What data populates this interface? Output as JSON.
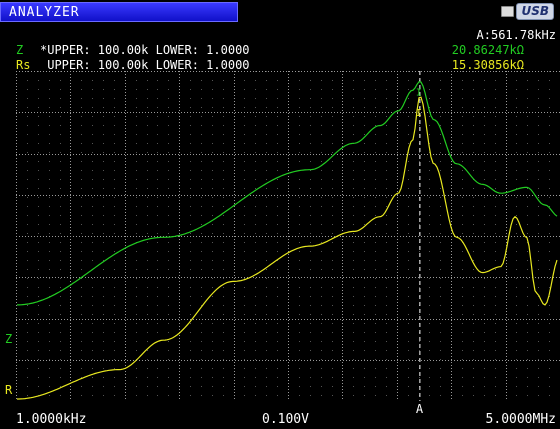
{
  "header": {
    "title": "ANALYZER",
    "usb_label": "USB"
  },
  "readout": {
    "cursor": "A:561.78kHz",
    "z_name": "Z",
    "z_limits": "*UPPER: 100.00k LOWER: 1.0000",
    "z_value": "20.86247kΩ",
    "rs_name": "Rs",
    "rs_limits": " UPPER: 100.00k LOWER: 1.0000",
    "rs_value": "15.30856kΩ"
  },
  "plot": {
    "z_marker": "Z",
    "r_marker": "R",
    "cursor_marker": "A",
    "x_start": "1.0000kHz",
    "x_center": "0.100V",
    "x_end": "5.0000MHz"
  },
  "colors": {
    "z": "#22cc22",
    "rs": "#e8e820",
    "grid": "#9a9a9a",
    "tab": "#2020e0"
  },
  "chart_data": {
    "type": "line",
    "xscale": "log",
    "xlim": [
      "1.0000kHz",
      "5.0000MHz"
    ],
    "grid": true,
    "cursor": {
      "label": "A",
      "x": "561.78kHz"
    },
    "series": [
      {
        "name": "Z",
        "color": "#22cc22",
        "x_khz": [
          1,
          10,
          100,
          200,
          300,
          400,
          500,
          561.78,
          700,
          1000,
          1500,
          2000,
          3000,
          4000,
          5000
        ],
        "y_rel": [
          0.32,
          0.55,
          0.78,
          0.87,
          0.93,
          0.98,
          1.05,
          1.08,
          0.95,
          0.8,
          0.73,
          0.7,
          0.72,
          0.66,
          0.62
        ]
      },
      {
        "name": "Rs",
        "color": "#e8e820",
        "x_khz": [
          1,
          5,
          10,
          30,
          100,
          200,
          300,
          400,
          500,
          561.78,
          700,
          1000,
          1500,
          2000,
          2500,
          3000,
          3500,
          4000,
          5000
        ],
        "y_rel": [
          0.0,
          0.1,
          0.2,
          0.4,
          0.52,
          0.57,
          0.62,
          0.7,
          0.88,
          1.03,
          0.8,
          0.55,
          0.43,
          0.45,
          0.62,
          0.55,
          0.36,
          0.32,
          0.48
        ]
      }
    ]
  }
}
